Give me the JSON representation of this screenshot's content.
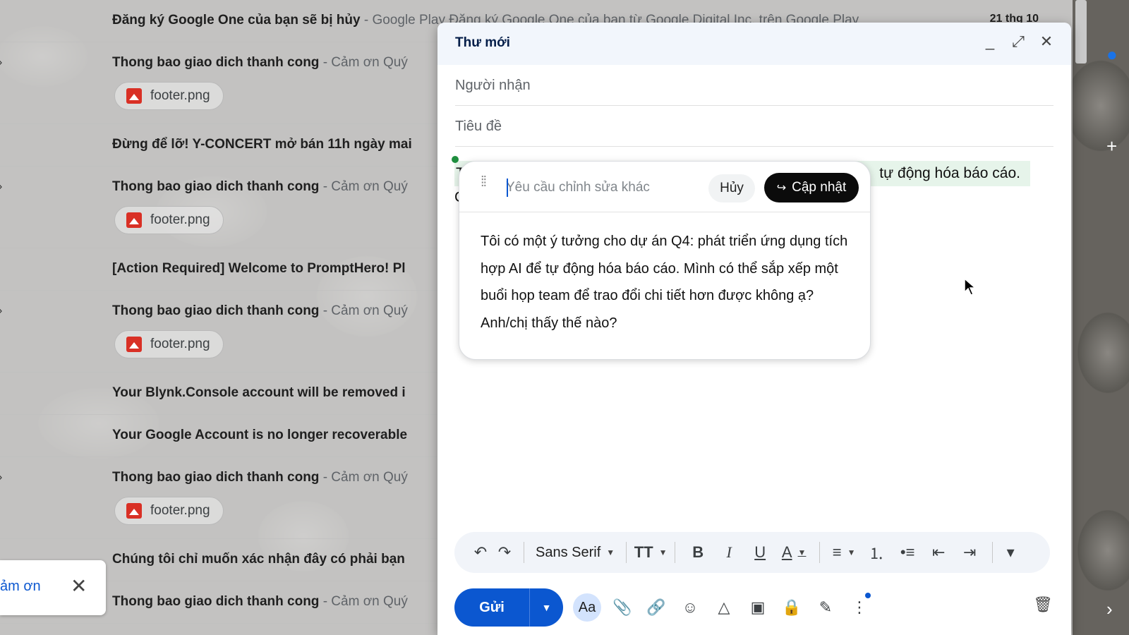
{
  "email_list": {
    "rows": [
      {
        "subject": "Đăng ký Google One của bạn sẽ bị hủy",
        "snippet": " - Google Play Đăng ký Google One của bạn từ Google Digital Inc. trên Google Play",
        "date": "21 thg 10"
      },
      {
        "subject": "Thong bao giao dich thanh cong",
        "snippet": " - Cảm ơn Quý",
        "attachment": "footer.png"
      },
      {
        "subject": "Đừng để lỡ! Y-CONCERT mở bán 11h ngày mai",
        "snippet": ""
      },
      {
        "subject": "Thong bao giao dich thanh cong",
        "snippet": " - Cảm ơn Quý",
        "attachment": "footer.png"
      },
      {
        "subject": "[Action Required] Welcome to PromptHero! Pl",
        "snippet": ""
      },
      {
        "subject": "Thong bao giao dich thanh cong",
        "snippet": " - Cảm ơn Quý",
        "attachment": "footer.png"
      },
      {
        "subject": "Your Blynk.Console account will be removed i",
        "snippet": ""
      },
      {
        "subject": "Your Google Account is no longer recoverable",
        "snippet": ""
      },
      {
        "subject": "Thong bao giao dich thanh cong",
        "snippet": " - Cảm ơn Quý",
        "attachment": "footer.png"
      },
      {
        "subject": "Chúng tôi chỉ muốn xác nhận đây có phải bạn",
        "snippet": ""
      },
      {
        "subject": "Thong bao giao dich thanh cong",
        "snippet": " - Cảm ơn Quý"
      }
    ]
  },
  "toast": {
    "text": "ảm ơn",
    "close": "✕"
  },
  "compose": {
    "title": "Thư mới",
    "minimize": "_",
    "expand": "⤢",
    "close": "✕",
    "to_placeholder": "Người nhận",
    "subject_placeholder": "Tiêu đề",
    "body_visible_start": "T",
    "body_visible_end": "tự động hóa báo cáo.",
    "body_line2": "C"
  },
  "ai_popup": {
    "input_placeholder": "Yêu cầu chỉnh sửa khác",
    "cancel_label": "Hủy",
    "update_label": "Cập nhật",
    "update_icon": "↪",
    "suggestion": "Tôi có một ý tưởng cho dự án Q4: phát triển ứng dụng tích hợp AI để tự động hóa báo cáo. Mình có thể sắp xếp một buổi họp team để trao đổi chi tiết hơn được không ạ? Anh/chị thấy thế nào?"
  },
  "format_toolbar": {
    "undo": "↶",
    "redo": "↷",
    "font": "Sans Serif",
    "size": "TT",
    "bold": "B",
    "italic": "I",
    "underline": "U",
    "text_color": "A",
    "align": "≡",
    "numbered": "⒈",
    "bulleted": "•≡",
    "indent_less": "⇤",
    "indent_more": "⇥",
    "more": "▾"
  },
  "bottom_bar": {
    "send_label": "Gửi",
    "send_menu": "▼",
    "formatting": "Aa",
    "attach": "📎",
    "link": "🔗",
    "emoji": "☺",
    "drive": "△",
    "photo": "▣",
    "confidential": "🔒",
    "signature": "✎",
    "more": "⋮",
    "discard": "🗑"
  },
  "right_rail": {
    "add": "+",
    "chevron": "›"
  },
  "colors": {
    "send_blue": "#0b57d0",
    "highlight_green": "#e6f4ea",
    "compose_header": "#f2f6fc"
  }
}
